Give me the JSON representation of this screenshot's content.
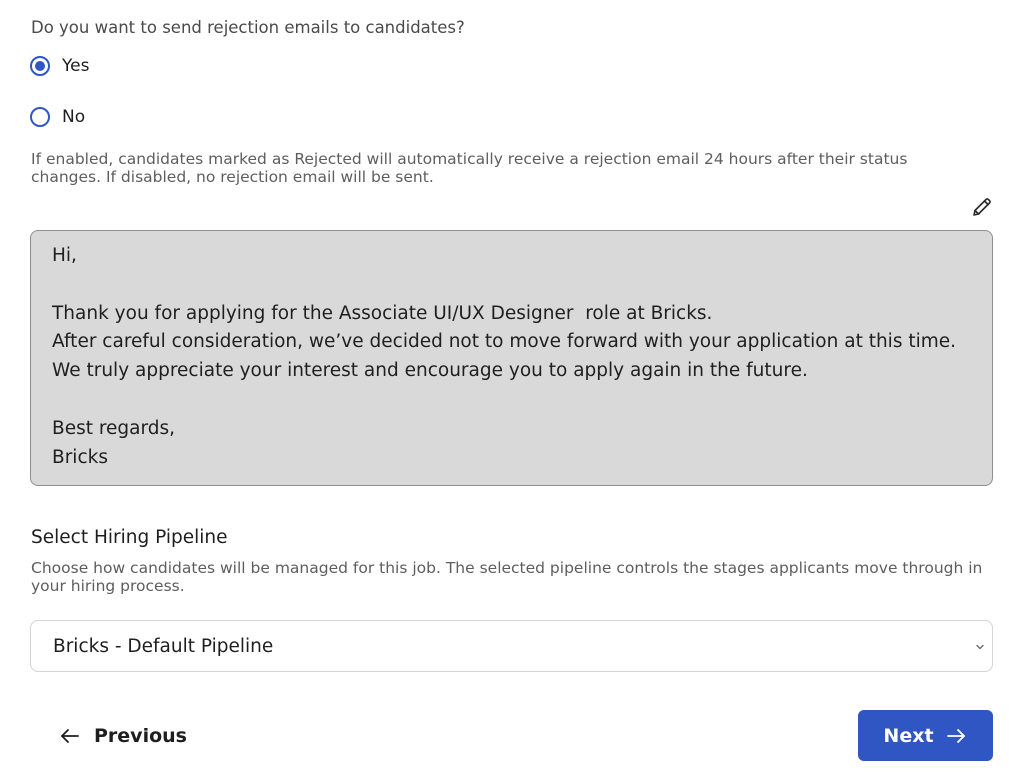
{
  "rejection": {
    "question": "Do you want to send rejection emails to candidates?",
    "options": [
      {
        "label": "Yes",
        "selected": true
      },
      {
        "label": "No",
        "selected": false
      }
    ],
    "help_text": "If enabled, candidates marked as Rejected will automatically receive a rejection email 24 hours after their status changes. If disabled, no rejection email will be sent.",
    "edit_icon": "pencil-icon",
    "email_template": "Hi,\n\nThank you for applying for the Associate UI/UX Designer  role at Bricks.\nAfter careful consideration, we’ve decided not to move forward with your application at this time.\nWe truly appreciate your interest and encourage you to apply again in the future.\n\nBest regards,\nBricks"
  },
  "pipeline": {
    "title": "Select Hiring Pipeline",
    "description": "Choose how candidates will be managed for this job. The selected pipeline controls the stages applicants move through in your hiring process.",
    "selected": "Bricks - Default Pipeline",
    "chevron_icon": "chevron-down-icon"
  },
  "footer": {
    "previous_label": "Previous",
    "previous_icon": "arrow-left-icon",
    "next_label": "Next",
    "next_icon": "arrow-right-icon"
  },
  "colors": {
    "accent": "#2f56c3",
    "template_background": "#d9d9d9"
  }
}
